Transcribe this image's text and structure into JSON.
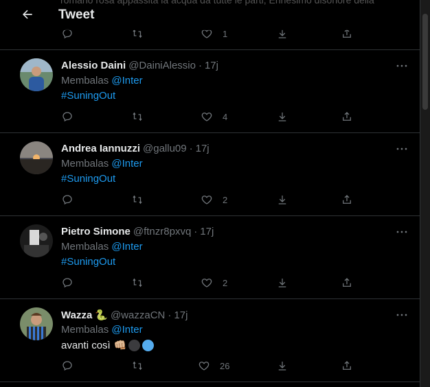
{
  "header": {
    "title": "Tweet",
    "ghost_text": "romano rosa appassita la acqua da tutte le parti, Ennesimo disonore della",
    "top_like_count": "1"
  },
  "tweets": [
    {
      "name": "Alessio Daini",
      "handle": "@DainiAlessio",
      "time": "17j",
      "reply_label": "Membalas",
      "mention": "@Inter",
      "hashtag": "#SuningOut",
      "like_count": "4"
    },
    {
      "name": "Andrea Iannuzzi",
      "handle": "@gallu09",
      "time": "17j",
      "reply_label": "Membalas",
      "mention": "@Inter",
      "hashtag": "#SuningOut",
      "like_count": "2"
    },
    {
      "name": "Pietro Simone",
      "handle": "@ftnzr8pxvq",
      "time": "17j",
      "reply_label": "Membalas",
      "mention": "@Inter",
      "hashtag": "#SuningOut",
      "like_count": "2"
    },
    {
      "name": "Wazza",
      "name_emoji": "🐍",
      "handle": "@wazzaCN",
      "time": "17j",
      "reply_label": "Membalas",
      "mention": "@Inter",
      "text": "avanti così",
      "emoji_fist": "👊🏼",
      "like_count": "26"
    }
  ],
  "icons": {
    "back": "arrow-left-icon",
    "reply": "reply-icon",
    "retweet": "retweet-icon",
    "like": "heart-icon",
    "bookmark": "bookmark-down-icon",
    "share": "share-icon",
    "more": "more-icon"
  },
  "colors": {
    "background": "#000000",
    "text": "#e7e9ea",
    "muted": "#71767b",
    "link": "#1d9bf0",
    "divider": "#2f3336",
    "emoji_dark": "#3b3b3e",
    "emoji_blue": "#55acee",
    "snake_green": "#78b159"
  }
}
